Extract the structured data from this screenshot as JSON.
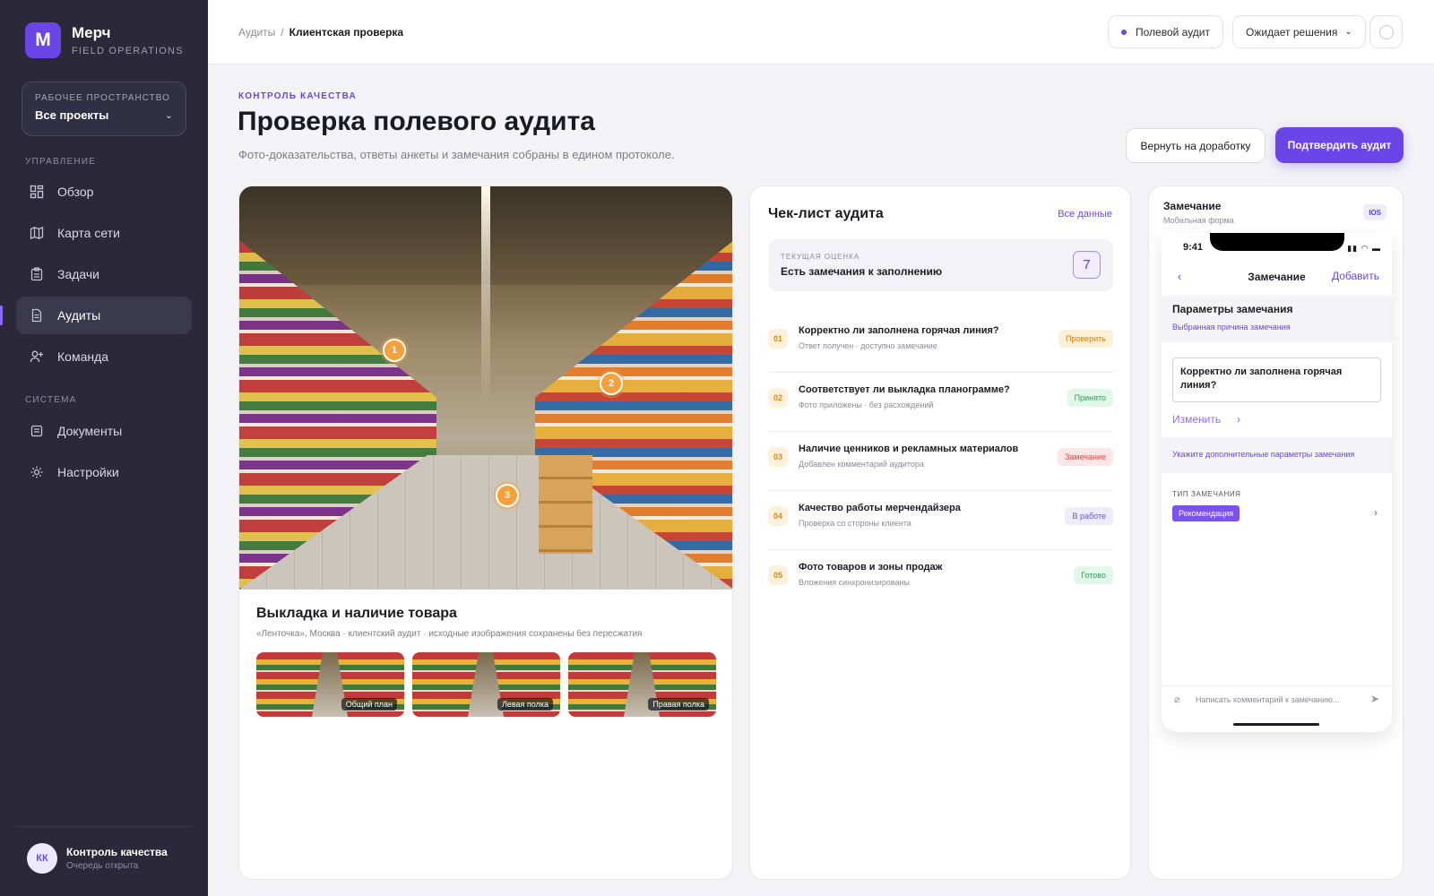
{
  "brand": {
    "logo_letter": "M",
    "name": "Мерч",
    "subtitle": "FIELD OPERATIONS"
  },
  "workspace": {
    "label": "РАБОЧЕЕ ПРОСТРАНСТВО",
    "value": "Все проекты"
  },
  "nav": {
    "section_manage": "УПРАВЛЕНИЕ",
    "items": [
      {
        "label": "Обзор",
        "icon": "dashboard-icon"
      },
      {
        "label": "Карта сети",
        "icon": "map-icon"
      },
      {
        "label": "Задачи",
        "icon": "clipboard-icon"
      },
      {
        "label": "Аудиты",
        "icon": "audit-icon",
        "active": true
      },
      {
        "label": "Команда",
        "icon": "user-plus-icon"
      }
    ],
    "section_system": "СИСТЕМА",
    "system_items": [
      {
        "label": "Документы",
        "icon": "document-icon"
      },
      {
        "label": "Настройки",
        "icon": "gear-icon"
      }
    ]
  },
  "user": {
    "initials": "КК",
    "name": "Контроль качества",
    "status": "Очередь открыта"
  },
  "topbar": {
    "breadcrumb_root": "Аудиты",
    "breadcrumb_sep": "/",
    "breadcrumb_current": "Клиентская проверка",
    "chip_type": "Полевой аудит",
    "chip_status": "Ожидает решения"
  },
  "header": {
    "eyebrow": "КОНТРОЛЬ КАЧЕСТВА",
    "title": "Проверка полевого аудита",
    "subtitle": "Фото-доказательства, ответы анкеты и замечания собраны в едином протоколе.",
    "btn_return": "Вернуть на доработку",
    "btn_confirm": "Подтвердить аудит"
  },
  "photo": {
    "pins": [
      "1",
      "2",
      "3"
    ],
    "title": "Выкладка и наличие товара",
    "meta": "«Ленточка», Москва · клиентский аудит · исходные изображения сохранены без пересжатия",
    "thumbs": [
      "Общий план",
      "Левая полка",
      "Правая полка"
    ]
  },
  "checklist": {
    "title": "Чек-лист аудита",
    "link": "Все данные",
    "score_label": "ТЕКУЩАЯ ОЦЕНКА",
    "score_text": "Есть замечания к заполнению",
    "score_value": "7",
    "rows": [
      {
        "num": "01",
        "q": "Корректно ли заполнена горячая линия?",
        "s": "Ответ получен · доступно замечание",
        "badge": "Проверить",
        "badge_bg": "#fdf0d9",
        "badge_fg": "#c97c12"
      },
      {
        "num": "02",
        "q": "Соответствует ли выкладка планограмме?",
        "s": "Фото приложены · без расхождений",
        "badge": "Принято",
        "badge_bg": "#e3f6ea",
        "badge_fg": "#2f9a5a"
      },
      {
        "num": "03",
        "q": "Наличие ценников и рекламных материалов",
        "s": "Добавлен комментарий аудитора",
        "badge": "Замечание",
        "badge_bg": "#fde6e6",
        "badge_fg": "#d14a4a"
      },
      {
        "num": "04",
        "q": "Качество работы мерчендайзера",
        "s": "Проверка со стороны клиента",
        "badge": "В работе",
        "badge_bg": "#eeebfa",
        "badge_fg": "#6a55c8"
      },
      {
        "num": "05",
        "q": "Фото товаров и зоны продаж",
        "s": "Вложения синхронизированы",
        "badge": "Готово",
        "badge_bg": "#e3f6ea",
        "badge_fg": "#2f9a5a"
      }
    ]
  },
  "mobile": {
    "title": "Замечание",
    "subtitle": "Мобильная форма",
    "platform": "IOS",
    "time": "9:41",
    "nav_back": "‹",
    "nav_title": "Замечание",
    "nav_add": "Добавить",
    "section_title": "Параметры замечания",
    "section_link": "Выбранная причина замечания",
    "field_value": "Корректно ли заполнена горячая линия?",
    "change": "Изменить",
    "hint": "Укажите дополнительные параметры замечания",
    "type_label": "ТИП ЗАМЕЧАНИЯ",
    "type_value": "Рекомендация",
    "compose_placeholder": "Написать комментарий к замечанию..."
  },
  "colors": {
    "accent": "#6c45e8",
    "sidebar": "#2a2839",
    "pin": "#f4a13b"
  }
}
